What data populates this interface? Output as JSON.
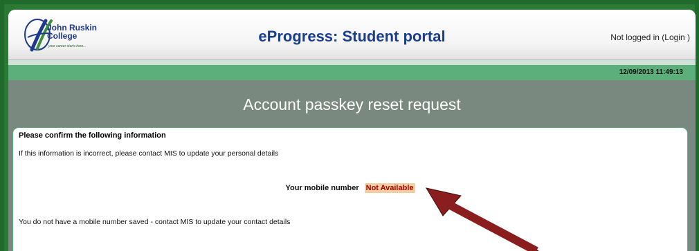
{
  "header": {
    "logo_name": "John Ruskin\nCollege",
    "logo_tagline": "your career starts here...",
    "title": "eProgress: Student portal",
    "login_status": "Not logged in (",
    "login_link": "Login",
    "login_close": " )"
  },
  "datebar": {
    "datetime": "12/09/2013 11:49:13"
  },
  "section": {
    "title": "Account passkey reset request"
  },
  "panel": {
    "heading": "Please confirm the following information",
    "info": "If this information is incorrect, please contact MIS to update your personal details",
    "mobile_label": "Your mobile number",
    "mobile_value": "Not Available",
    "note": "You do not have a mobile number saved - contact MIS to update your contact details"
  },
  "colors": {
    "frame": "#2a7a35",
    "title_blue": "#1a3e8e",
    "datebar": "#5cae7a",
    "section_gray": "#79897f",
    "alert_red": "#b40000",
    "alert_bg": "#f2cfa0",
    "arrow": "#7a1a1a"
  }
}
